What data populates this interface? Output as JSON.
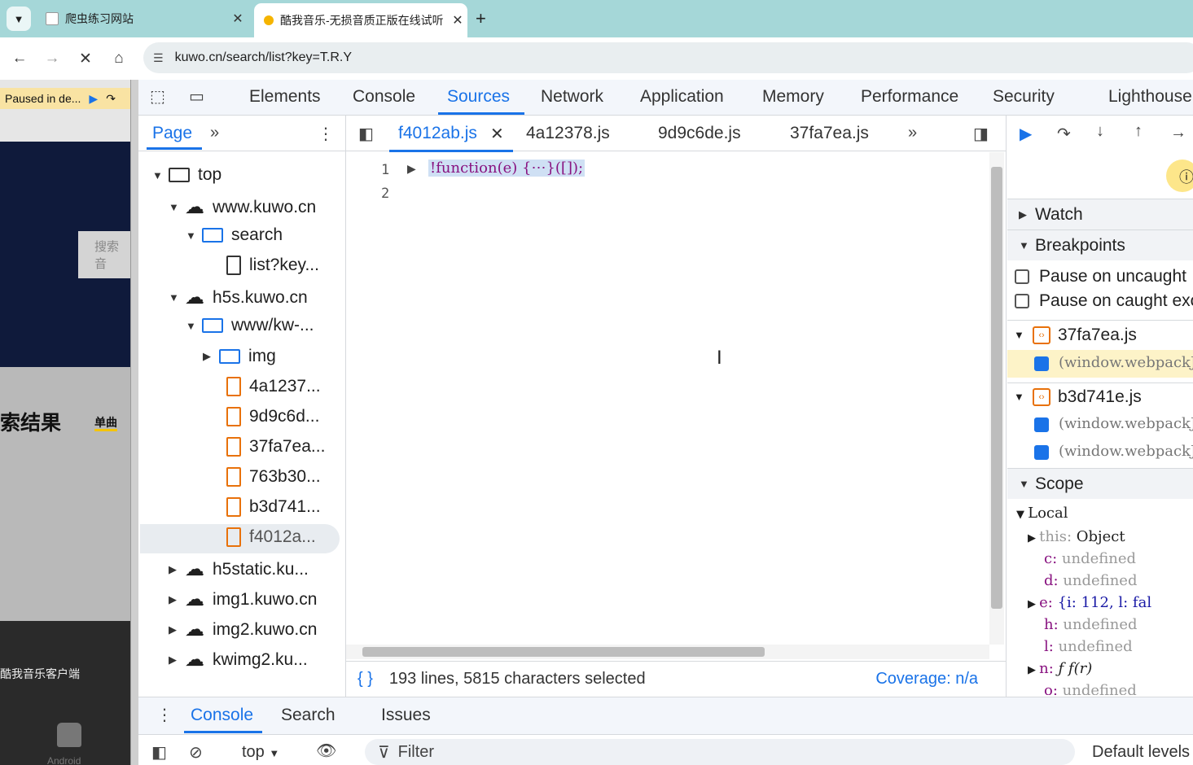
{
  "browser": {
    "tabs": [
      {
        "title": "爬虫练习网站",
        "active": false
      },
      {
        "title": "酷我音乐-无损音质正版在线试听",
        "active": true
      }
    ],
    "url": "kuwo.cn/search/list?key=T.R.Y"
  },
  "page": {
    "paused_label": "Paused in de...",
    "search_placeholder": "搜索音",
    "result_title": "索结果",
    "tab_single": "单曲",
    "client_text": "酷我音乐客户端",
    "android_label": "Android"
  },
  "devtools": {
    "tabs": [
      "Elements",
      "Console",
      "Sources",
      "Network",
      "Application",
      "Memory",
      "Performance",
      "Security",
      "Lighthouse"
    ],
    "active_tab": "Sources",
    "navigator": {
      "tab": "Page",
      "tree": [
        {
          "label": "top",
          "type": "frame"
        },
        {
          "label": "www.kuwo.cn",
          "type": "domain"
        },
        {
          "label": "search",
          "type": "folder"
        },
        {
          "label": "list?key...",
          "type": "file"
        },
        {
          "label": "h5s.kuwo.cn",
          "type": "domain"
        },
        {
          "label": "www/kw-...",
          "type": "folder"
        },
        {
          "label": "img",
          "type": "folder"
        },
        {
          "label": "4a1237...",
          "type": "js"
        },
        {
          "label": "9d9c6d...",
          "type": "js"
        },
        {
          "label": "37fa7ea...",
          "type": "js"
        },
        {
          "label": "763b30...",
          "type": "js"
        },
        {
          "label": "b3d741...",
          "type": "js"
        },
        {
          "label": "f4012a...",
          "type": "js"
        },
        {
          "label": "h5static.ku...",
          "type": "domain"
        },
        {
          "label": "img1.kuwo.cn",
          "type": "domain"
        },
        {
          "label": "img2.kuwo.cn",
          "type": "domain"
        },
        {
          "label": "kwimg2.ku...",
          "type": "domain"
        }
      ]
    },
    "editor": {
      "tabs": [
        "f4012ab.js",
        "4a12378.js",
        "9d9c6de.js",
        "37fa7ea.js"
      ],
      "active_tab": "f4012ab.js",
      "line_numbers": [
        "1",
        "2"
      ],
      "code_line": "!function(e) {⋯}([]);",
      "status": "193 lines, 5815 characters selected",
      "coverage": "Coverage: n/a"
    },
    "debugger": {
      "watch": "Watch",
      "breakpoints": "Breakpoints",
      "pause_uncaught": "Pause on uncaught",
      "pause_caught": "Pause on caught exc",
      "files": [
        {
          "name": "37fa7ea.js",
          "entries": [
            "(window.webpackJs"
          ]
        },
        {
          "name": "b3d741e.js",
          "entries": [
            "(window.webpackJs",
            "(window.webpackJs"
          ]
        }
      ],
      "scope": "Scope",
      "local": "Local",
      "vars": {
        "this_k": "this:",
        "this_v": "Object",
        "c_k": "c:",
        "c_v": "undefined",
        "d_k": "d:",
        "d_v": "undefined",
        "e_k": "e:",
        "e_v": "{i: 112, l: fal",
        "h_k": "h:",
        "h_v": "undefined",
        "l_k": "l:",
        "l_v": "undefined",
        "n_k": "n:",
        "n_v": "ƒ f(r)",
        "o_k": "o:",
        "o_v": "undefined"
      }
    },
    "drawer": {
      "tabs": [
        "Console",
        "Search",
        "Issues"
      ],
      "context": "top",
      "filter": "Filter",
      "levels": "Default levels"
    }
  }
}
